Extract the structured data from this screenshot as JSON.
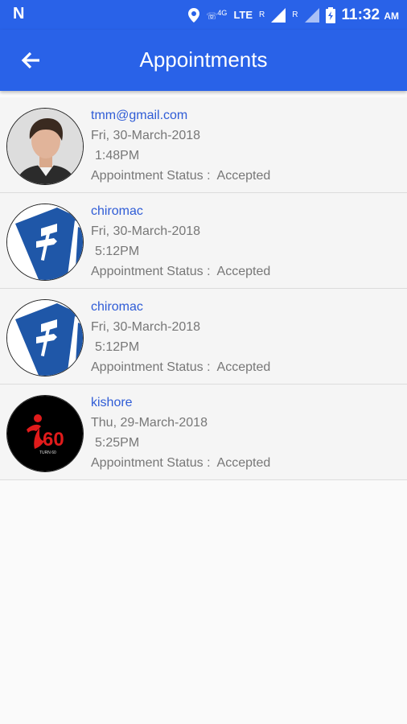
{
  "status_bar": {
    "network_label": "4G",
    "lte_label": "LTE",
    "roaming_1": "R",
    "roaming_2": "R",
    "time": "11:32",
    "ampm": "AM"
  },
  "app_bar": {
    "title": "Appointments",
    "back_icon": "arrow-left-icon"
  },
  "appointments": [
    {
      "name": "tmm@gmail.com",
      "date": "Fri, 30-March-2018",
      "time": "1:48PM",
      "status_label": "Appointment Status :",
      "status": "Accepted",
      "avatar": "person-photo"
    },
    {
      "name": "chiromac",
      "date": "Fri, 30-March-2018",
      "time": "5:12PM",
      "status_label": "Appointment Status :",
      "status": "Accepted",
      "avatar": "signpost-logo"
    },
    {
      "name": "chiromac",
      "date": "Fri, 30-March-2018",
      "time": "5:12PM",
      "status_label": "Appointment Status :",
      "status": "Accepted",
      "avatar": "signpost-logo"
    },
    {
      "name": "kishore",
      "date": "Thu, 29-March-2018",
      "time": "5:25PM",
      "status_label": "Appointment Status :",
      "status": "Accepted",
      "avatar": "60-logo"
    }
  ],
  "colors": {
    "primary": "#2962e8",
    "link": "#2f5cd6"
  }
}
